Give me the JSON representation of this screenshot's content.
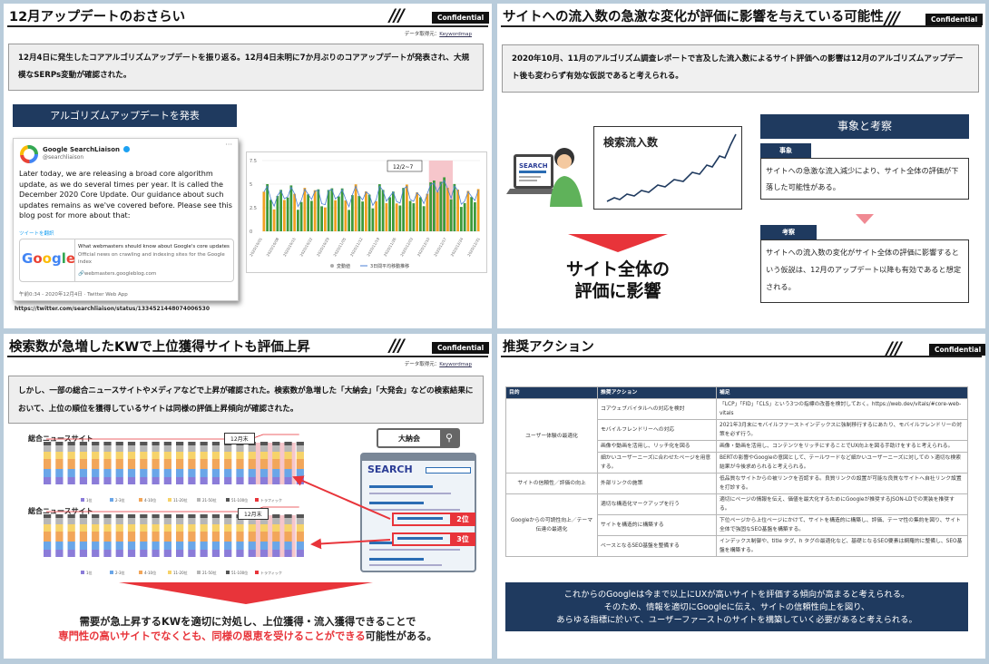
{
  "conf": "Confidential",
  "slide1": {
    "title": "12月アップデートのおさらい",
    "source_label": "データ取得元：",
    "source_link": "Keywordmap",
    "text": "12月4日に発生したコアアルゴリズムアップデートを振り返る。12月4日未明に7か月ぶりのコアアップデートが発表され、大規模なSERPs変動が確認された。",
    "banner": "アルゴリズムアップデートを発表",
    "tweet": {
      "name": "Google SearchLiaison",
      "handle": "@searchliaison",
      "body": "Later today, we are releasing a broad core algorithm update, as we do several times per year. It is called the December 2020 Core Update. Our guidance about such updates remains as we've covered before. Please see this blog post for more about that:",
      "translate": "ツイートを翻訳",
      "card_title": "What webmasters should know about Google's core updates",
      "card_desc": "Official news on crawling and indexing sites for the Google index",
      "card_link": "webmasters.googleblog.com",
      "time": "午前0:34 - 2020年12月4日 · Twitter Web App"
    },
    "url": "https://twitter.com/searchliaison/status/1334521448074006530"
  },
  "chart1": {
    "callout": "12/2~7",
    "y_ticks": [
      "7.5",
      "5",
      "2.5",
      "0"
    ],
    "legend": [
      "変動値",
      "3日間平均移動推移"
    ],
    "x_ticks": [
      "2020/10/01",
      "2020/10/08",
      "2020/10/15",
      "2020/10/22",
      "2020/10/29",
      "2020/11/05",
      "2020/11/12",
      "2020/11/19",
      "2020/11/26",
      "2020/12/03",
      "2020/12/10",
      "2020/12/17",
      "2020/12/24",
      "2020/12/31"
    ]
  },
  "slide2": {
    "title": "サイトへの流入数の急激な変化が評価に影響を与えている可能性",
    "text": "2020年10月、11月のアルゴリズム調査レポートで言及した流入数によるサイト評価への影響は12月のアルゴリズムアップデート後も変わらず有効な仮説であると考えられる。",
    "search_word": "SEARCH",
    "graph_label": "検索流入数",
    "conclusion": [
      "サイト全体の",
      "評価に影響"
    ],
    "panel_title": "事象と考察",
    "fact_tag": "事象",
    "fact": "サイトへの急激な流入減少により、サイト全体の評価が下落した可能性がある。",
    "insight_tag": "考察",
    "insight": "サイトへの流入数の変化がサイト全体の評価に影響するという仮説は、12月のアップデート以降も有効であると想定される。"
  },
  "slide3": {
    "title": "検索数が急増したKWで上位獲得サイトも評価上昇",
    "source_label": "データ取得元：",
    "source_link": "Keywordmap",
    "text": "しかし、一部の総合ニュースサイトやメディアなどで上昇が確認された。検索数が急増した「大納会」「大発会」などの検索結果において、上位の順位を獲得しているサイトは同様の評価上昇傾向が確認された。",
    "chart_a": "総合ニュースサイト",
    "chart_b": "総合ニュースサイト",
    "callout": "12月末",
    "keyword": "大納会",
    "search_word": "SEARCH",
    "rank2": "2位",
    "rank3": "3位",
    "legend": [
      "1位",
      "2-3位",
      "4-10位",
      "11-20位",
      "21-50位",
      "51-100位",
      "トラフィック"
    ],
    "bottom1": "需要が急上昇するKWを適切に対処し、上位獲得・流入獲得できることで",
    "bottom2_red": "専門性の高いサイトでなくとも、同様の恩恵を受けることができる",
    "bottom2_tail": "可能性がある。"
  },
  "slide4": {
    "title": "推奨アクション",
    "headers": [
      "目的",
      "推奨アクション",
      "補足"
    ],
    "rows": [
      {
        "purpose": "ユーザー体験の最適化",
        "span": 4,
        "action": "コアウェブバイタルへの対応を検討",
        "note": "「LCP」「FID」「CLS」という3つの指標の改善を検討しておく。https://web.dev/vitals/#core-web-vitals"
      },
      {
        "action": "モバイルフレンドリーへの対応",
        "note": "2021年3月末にモバイルファーストインデックスに強制移行するにあたり、モバイルフレンドリーの対策を必ず行う。"
      },
      {
        "action": "画像や動画を活用し、リッチ化を図る",
        "note": "画像・動画を活用し、コンテンツをリッチにすることでUX向上を図る手助けをすると考えられる。"
      },
      {
        "action": "細かいユーザーニーズに合わせたページを用意する。",
        "note": "BERTの影響やGoogleの意図として、テールワードなど細かいユーザーニーズに対してのゝ適切な検索結果が今後求められると考えられる。"
      },
      {
        "purpose": "サイトの信頼性／評価の向上",
        "span": 1,
        "action": "外部リンクの施策",
        "note": "低品質なサイトからの被リンクを否認する。良質リンクの設置が可能な良質なサイトへ自社リンク設置を打診する。"
      },
      {
        "purpose": "Googleからの可読性向上／テーマ伝達の最適化",
        "span": 3,
        "action": "適切な構造化マークアップを行う",
        "note": "適切にページの情報を伝え、価値を最大化するためにGoogleが推奨するJSON-LDでの実装を推奨する。"
      },
      {
        "action": "サイトを構造的に構築する",
        "note": "下位ページから上位ページにかけて、サイトを構造的に構築し、評価、テーマ性の集約を図り、サイト全体で強固なSEO基盤を構築する。"
      },
      {
        "action": "ベースとなるSEO基盤を整備する",
        "note": "インデックス制御や、title タグ、h タグの最適化など、基礎となるSEO要素は網羅的に整備し、SEO基盤を構築する。"
      }
    ],
    "conclusion": [
      "これからのGoogleは今まで以上にUXが高いサイトを評価する傾向が高まると考えられる。",
      "そのため、情報を適切にGoogleに伝え、サイトの信頼性向上を図り、",
      "あらゆる指標に於いて、ユーザーファーストのサイトを構築していく必要があると考えられる。"
    ]
  },
  "colors": {
    "navy": "#1f3a5f",
    "red": "#e8343a",
    "green": "#3d9a3b",
    "orange": "#f0a020"
  }
}
